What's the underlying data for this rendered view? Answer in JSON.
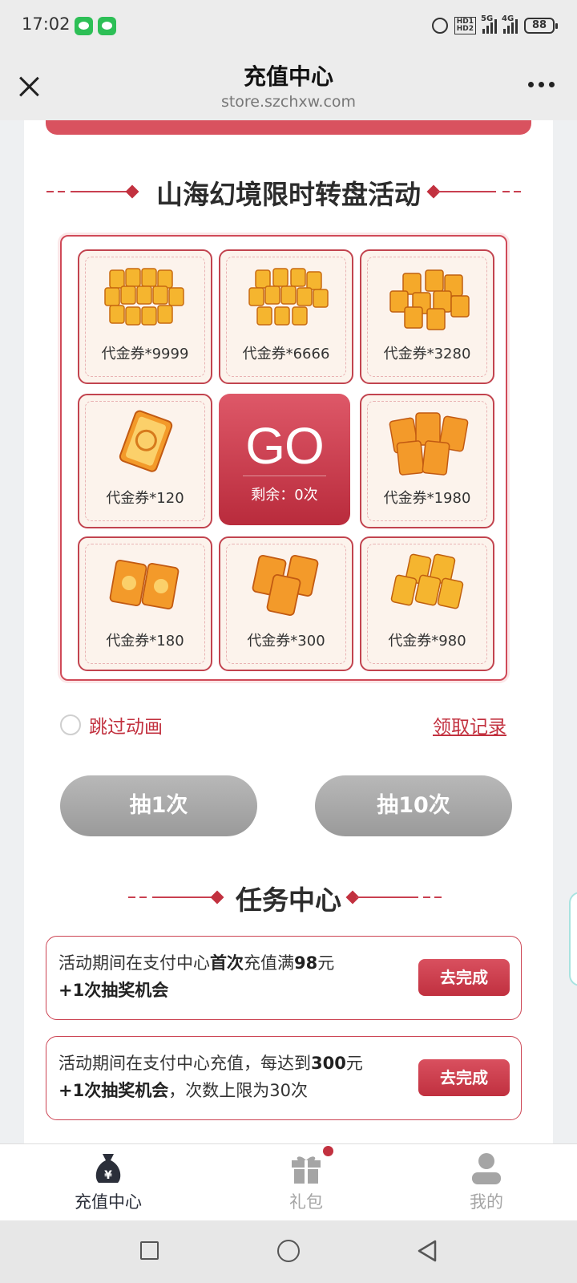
{
  "status_bar": {
    "time": "17:02",
    "apps": [
      "message-icon",
      "wechat-icon"
    ],
    "network_1": "5G",
    "network_2": "4G",
    "battery": "88"
  },
  "title_bar": {
    "title": "充值中心",
    "subtitle": "store.szchxw.com"
  },
  "lottery": {
    "title": "山海幻境限时转盘活动",
    "prizes": [
      {
        "label": "代金券*9999",
        "icon": "voucher-pile-icon"
      },
      {
        "label": "代金券*6666",
        "icon": "voucher-pile-icon"
      },
      {
        "label": "代金券*3280",
        "icon": "voucher-pile-icon"
      },
      {
        "label": "代金券*120",
        "icon": "voucher-icon"
      },
      {
        "label": "代金券*1980",
        "icon": "voucher-stack-icon"
      },
      {
        "label": "代金券*180",
        "icon": "voucher-pair-icon"
      },
      {
        "label": "代金券*300",
        "icon": "voucher-trio-icon"
      },
      {
        "label": "代金券*980",
        "icon": "voucher-stack-icon"
      }
    ],
    "go_label": "GO",
    "remaining": "剩余：0次",
    "skip_animation": "跳过动画",
    "record_link": "领取记录",
    "draw_once": "抽1次",
    "draw_ten": "抽10次"
  },
  "tasks": {
    "title": "任务中心",
    "items": [
      {
        "line1_a": "活动期间在支付中心",
        "line1_b": "首次",
        "line1_c": "充值满",
        "line1_d": "98",
        "line1_e": "元",
        "line2_a": "+1次抽奖机会",
        "line2_b": "",
        "button": "去完成"
      },
      {
        "line1_a": "活动期间在支付中心充值，每达到",
        "line1_b": "",
        "line1_c": "",
        "line1_d": "300",
        "line1_e": "元",
        "line2_a": "+1次抽奖机会",
        "line2_b": "，次数上限为30次",
        "button": "去完成"
      }
    ]
  },
  "bottom_nav": [
    {
      "label": "充值中心",
      "icon": "money-bag-icon",
      "active": true
    },
    {
      "label": "礼包",
      "icon": "gift-icon",
      "active": false
    },
    {
      "label": "我的",
      "icon": "user-icon",
      "active": false
    }
  ],
  "colors": {
    "accent": "#c2313f",
    "accent_light": "#d9525f",
    "button_gray": "#a8a8a8",
    "card_bg": "#fcf3ec",
    "nav_active": "#2b2f3a",
    "nav_inactive": "#a5a5a5"
  }
}
